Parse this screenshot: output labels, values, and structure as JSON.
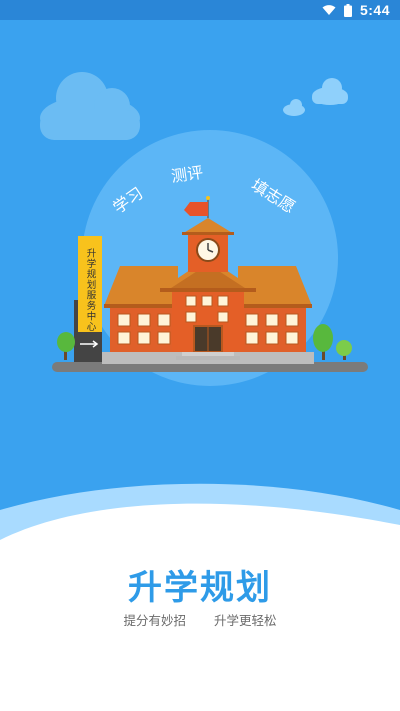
{
  "status_bar": {
    "time": "5:44",
    "wifi_icon": "wifi-icon",
    "battery_icon": "battery-icon"
  },
  "illustration": {
    "arc_labels": [
      "学习",
      "测评",
      "填志愿"
    ],
    "sign_text": "升学规划服务中心"
  },
  "main": {
    "title": "升学规划",
    "slogan_left": "提分有妙招",
    "slogan_right": "升学更轻松"
  },
  "colors": {
    "sky": "#3aa2ef",
    "status_bar": "#2a86d7",
    "title": "#2e9be8",
    "building_roof": "#d9852b",
    "building_wall": "#e0602a"
  }
}
